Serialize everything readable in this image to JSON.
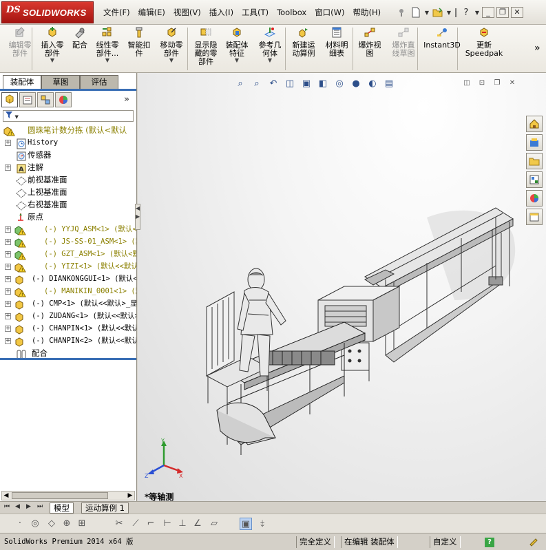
{
  "app": {
    "logo_mark": "DS",
    "logo_text": "SOLIDWORKS"
  },
  "menu": [
    "文件(F)",
    "编辑(E)",
    "视图(V)",
    "插入(I)",
    "工具(T)",
    "Toolbox",
    "窗口(W)",
    "帮助(H)"
  ],
  "quick_access": [
    "pin-icon",
    "new-document-icon",
    "open-icon",
    "help-icon"
  ],
  "window_buttons": [
    "minimize",
    "restore",
    "close"
  ],
  "ribbon": [
    {
      "label": "编辑零\n部件",
      "icon": "edit-component-icon",
      "disabled": true,
      "dropdown": false
    },
    {
      "label": "插入零\n部件",
      "icon": "insert-component-icon",
      "disabled": false,
      "dropdown": true
    },
    {
      "label": "配合",
      "icon": "mate-icon",
      "disabled": false,
      "dropdown": false
    },
    {
      "label": "线性零\n部件...",
      "icon": "linear-pattern-icon",
      "disabled": false,
      "dropdown": true
    },
    {
      "label": "智能扣\n件",
      "icon": "smart-fasteners-icon",
      "disabled": false,
      "dropdown": false
    },
    {
      "label": "移动零\n部件",
      "icon": "move-component-icon",
      "disabled": false,
      "dropdown": true
    },
    {
      "label": "显示隐\n藏的零\n部件",
      "icon": "show-hidden-icon",
      "disabled": false,
      "dropdown": false
    },
    {
      "label": "装配体\n特征",
      "icon": "assembly-features-icon",
      "disabled": false,
      "dropdown": true
    },
    {
      "label": "参考几\n何体",
      "icon": "reference-geometry-icon",
      "disabled": false,
      "dropdown": true
    },
    {
      "label": "新建运\n动算例",
      "icon": "motion-study-icon",
      "disabled": false,
      "dropdown": false
    },
    {
      "label": "材料明\n细表",
      "icon": "bom-icon",
      "disabled": false,
      "dropdown": false
    },
    {
      "label": "爆炸视\n图",
      "icon": "exploded-view-icon",
      "disabled": false,
      "dropdown": false
    },
    {
      "label": "爆炸直\n线草图",
      "icon": "explode-line-icon",
      "disabled": true,
      "dropdown": false
    },
    {
      "label": "Instant3D",
      "icon": "instant3d-icon",
      "disabled": false,
      "dropdown": false
    },
    {
      "label": "更新\nSpeedpak",
      "icon": "speedpak-icon",
      "disabled": false,
      "dropdown": false
    }
  ],
  "ribbon_more": "»",
  "command_tabs": [
    {
      "label": "装配体",
      "active": true
    },
    {
      "label": "草图",
      "active": false
    },
    {
      "label": "评估",
      "active": false
    }
  ],
  "manager_tabs": [
    "featuremanager-icon",
    "propertymanager-icon",
    "configurationmanager-icon",
    "displaymanager-icon"
  ],
  "collapse_glyph": "»",
  "filter_glyph": "▼",
  "tree": [
    {
      "expander": "",
      "icon": "assembly-warning-icon",
      "text": "圆珠笔计数分拣  (默认<默认",
      "style": "warn"
    },
    {
      "expander": "+",
      "icon": "history-icon",
      "text": "History",
      "style": "mono"
    },
    {
      "expander": "",
      "icon": "sensor-icon",
      "text": "传感器",
      "style": ""
    },
    {
      "expander": "+",
      "icon": "annotation-icon",
      "text": "注解",
      "style": ""
    },
    {
      "expander": "",
      "icon": "plane-icon",
      "text": "前视基准面",
      "style": ""
    },
    {
      "expander": "",
      "icon": "plane-icon",
      "text": "上视基准面",
      "style": ""
    },
    {
      "expander": "",
      "icon": "plane-icon",
      "text": "右视基准面",
      "style": ""
    },
    {
      "expander": "",
      "icon": "origin-icon",
      "text": "原点",
      "style": ""
    },
    {
      "expander": "+",
      "icon": "subassembly-warning-icon",
      "text": "(-) YYJQ_ASM<1> (默认<",
      "style": "warn mono"
    },
    {
      "expander": "+",
      "icon": "subassembly-warning-icon",
      "text": "(-) JS-SS-01_ASM<1> (默",
      "style": "warn mono"
    },
    {
      "expander": "+",
      "icon": "subassembly-warning-icon",
      "text": "(-) GZT_ASM<1> (默认<默",
      "style": "warn mono"
    },
    {
      "expander": "+",
      "icon": "part-warning-icon",
      "text": "(-) YIZI<1> (默认<<默认>",
      "style": "warn mono"
    },
    {
      "expander": "+",
      "icon": "part-icon",
      "text": "(-) DIANKONGGUI<1> (默认<",
      "style": "mono"
    },
    {
      "expander": "+",
      "icon": "part-warning-icon",
      "text": "(-) MANIKIN_0001<1> (默",
      "style": "warn mono"
    },
    {
      "expander": "+",
      "icon": "part-icon",
      "text": "(-) CMP<1> (默认<<默认>_显",
      "style": "mono"
    },
    {
      "expander": "+",
      "icon": "part-icon",
      "text": "(-) ZUDANG<1> (默认<<默认>",
      "style": "mono"
    },
    {
      "expander": "+",
      "icon": "part-icon",
      "text": "(-) CHANPIN<1> (默认<<默认>",
      "style": "mono"
    },
    {
      "expander": "+",
      "icon": "part-icon",
      "text": "(-) CHANPIN<2> (默认<<默认>",
      "style": "mono"
    },
    {
      "expander": "",
      "icon": "mates-icon",
      "text": "配合",
      "style": ""
    }
  ],
  "headsup_toolbar": [
    "zoom-to-fit-icon",
    "zoom-to-area-icon",
    "previous-view-icon",
    "section-view-icon",
    "view-orientation-icon",
    "display-style-icon",
    "hide-show-icon",
    "edit-appearance-icon",
    "apply-scene-icon",
    "view-settings-icon"
  ],
  "view_buttons": [
    "split-icon",
    "expand-icon",
    "tile-icon",
    "close-icon"
  ],
  "task_pane": [
    "resources-icon",
    "design-library-icon",
    "file-explorer-icon",
    "view-palette-icon",
    "appearances-icon",
    "custom-properties-icon"
  ],
  "view_name": "*等轴测",
  "triad": {
    "x": "X",
    "y": "Y",
    "z": "Z"
  },
  "bottom_tabs": [
    {
      "label": "模型",
      "active": true
    },
    {
      "label": "运动算例 1",
      "active": false
    }
  ],
  "sketch_tools": [
    "point-icon",
    "circle-icon",
    "polygon-icon",
    "centerpoint-icon",
    "grid-icon",
    "trim-icon",
    "offset-icon",
    "construction-icon",
    "smart-dimension-icon",
    "relations-icon",
    "angle-icon",
    "box-icon",
    "instant3d-toggle-icon",
    "perspective-icon"
  ],
  "status": {
    "version": "SolidWorks Premium 2014 x64 版",
    "definition": "完全定义",
    "mode": "在编辑 装配体",
    "units": "自定义",
    "help": "?"
  }
}
